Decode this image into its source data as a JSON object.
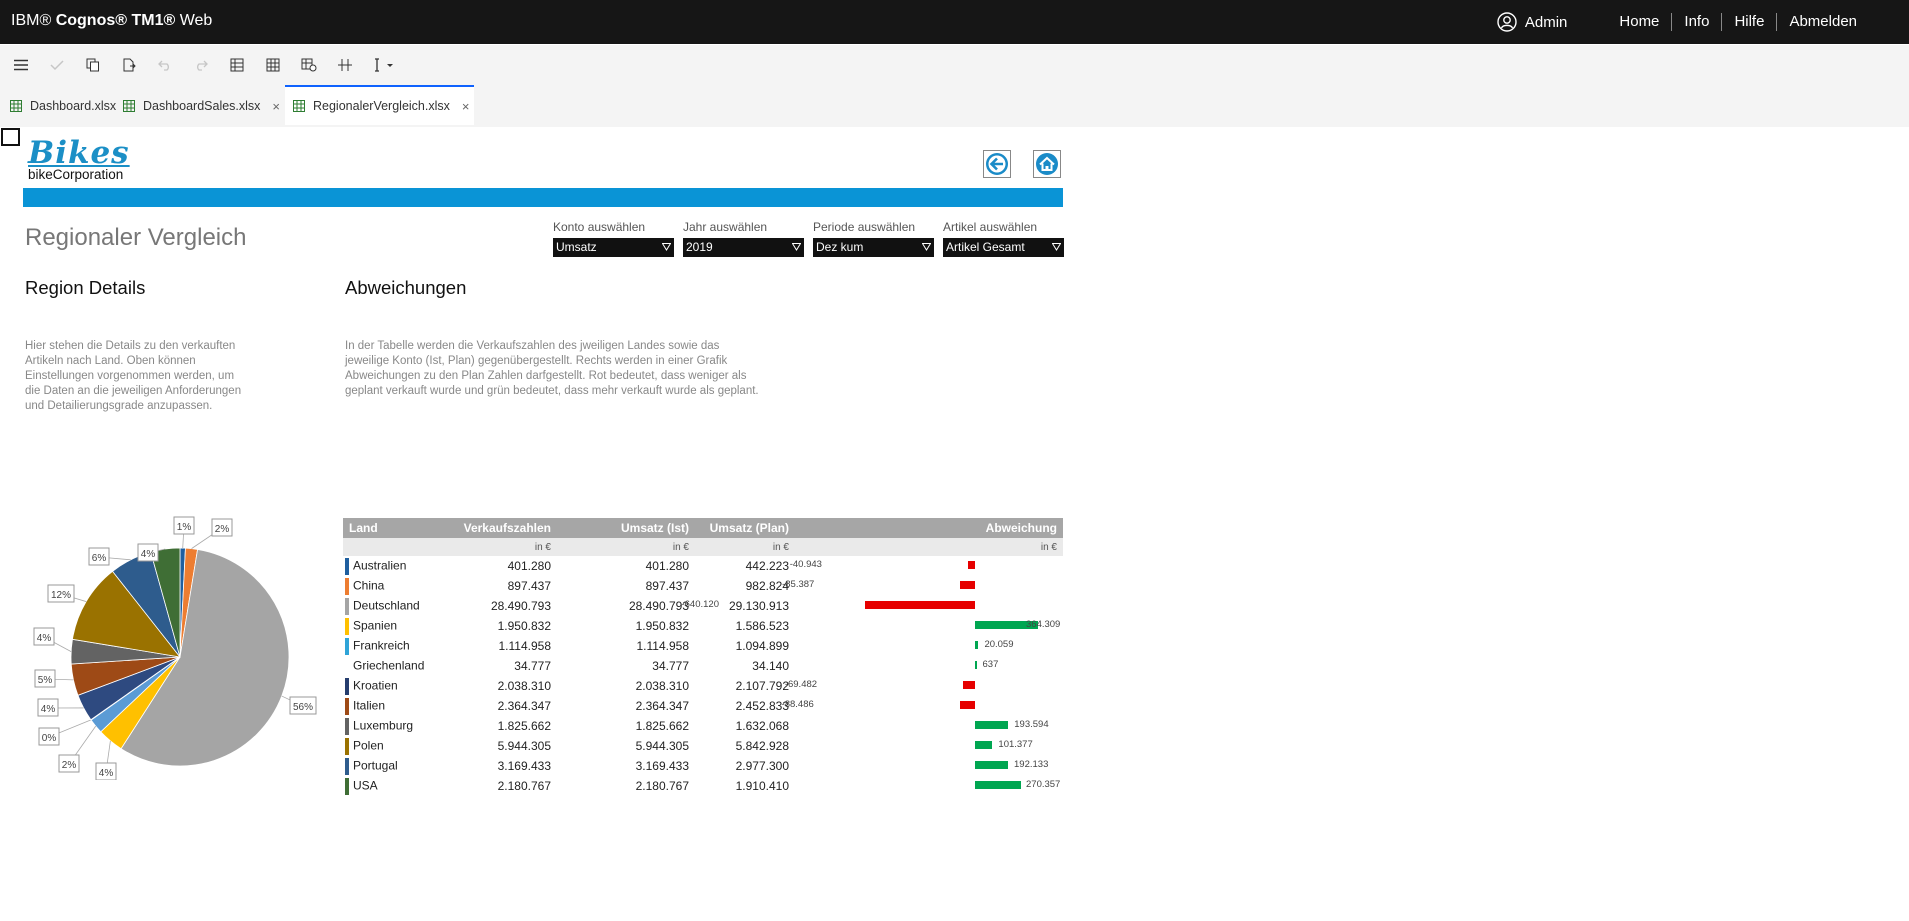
{
  "app": {
    "brand_prefix": "IBM® ",
    "brand_bold": "Cognos® TM1®",
    "brand_suffix": " Web",
    "user": "Admin",
    "nav": [
      "Home",
      "Info",
      "Hilfe",
      "Abmelden"
    ]
  },
  "toolbar": {
    "icons": [
      "menu-icon",
      "check-icon",
      "copy-icon",
      "paste-icon",
      "undo-icon",
      "redo-icon",
      "grid-icon",
      "grid-alt-icon",
      "grid-export-icon",
      "split-icon",
      "sandbox-icon"
    ]
  },
  "tabs": [
    {
      "label": "Dashboard.xlsx"
    },
    {
      "label": "DashboardSales.xlsx",
      "close": "×"
    },
    {
      "label": "RegionalerVergleich.xlsx",
      "close": "×"
    }
  ],
  "logo": {
    "bikes": "Bikes",
    "corp": "bikeCorporation"
  },
  "colors": {
    "accent": "#0a94d6",
    "negative": "#e60000",
    "positive": "#00a651"
  },
  "page": {
    "title": "Regionaler Vergleich"
  },
  "selectors": [
    {
      "label": "Konto auswählen",
      "value": "Umsatz"
    },
    {
      "label": "Jahr auswählen",
      "value": "2019"
    },
    {
      "label": "Periode auswählen",
      "value": "Dez kum"
    },
    {
      "label": "Artikel auswählen",
      "value": "Artikel Gesamt"
    }
  ],
  "region": {
    "heading": "Region Details",
    "text": [
      "Hier stehen die Details zu den verkauften",
      "Artikeln nach Land. Oben können",
      "Einstellungen vorgenommen werden, um",
      "die Daten an die jeweiligen Anforderungen",
      "und Detailierungsgrade anzupassen."
    ]
  },
  "abweichungen": {
    "heading": "Abweichungen",
    "text": [
      "In der Tabelle werden die Verkaufszahlen des jweiligen Landes sowie das",
      "jeweilige Konto (Ist, Plan) gegenübergestellt. Rechts werden in einer Grafik",
      "Abweichungen zu den Plan Zahlen darfgestellt. Rot bedeutet, dass weniger als",
      "geplant verkauft wurde und grün bedeutet, dass mehr verkauft wurde als geplant."
    ]
  },
  "table": {
    "headers": [
      "Land",
      "Verkaufszahlen",
      "Umsatz (Ist)",
      "Umsatz (Plan)",
      "Abweichung"
    ],
    "units": [
      "",
      "in €",
      "in €",
      "in €",
      "in €"
    ],
    "rows": [
      {
        "land": "Australien",
        "verkauf": "401.280",
        "ist": "401.280",
        "plan": "442.223",
        "abw": -40943,
        "abw_label": "-40.943",
        "color": "#1f5f9f"
      },
      {
        "land": "China",
        "verkauf": "897.437",
        "ist": "897.437",
        "plan": "982.824",
        "abw": -85387,
        "abw_label": "-85.387",
        "color": "#ed7d31"
      },
      {
        "land": "Deutschland",
        "verkauf": "28.490.793",
        "ist": "28.490.793",
        "plan": "29.130.913",
        "abw": -640120,
        "abw_label": "-640.120",
        "color": "#a5a5a5"
      },
      {
        "land": "Spanien",
        "verkauf": "1.950.832",
        "ist": "1.950.832",
        "plan": "1.586.523",
        "abw": 364309,
        "abw_label": "364.309",
        "color": "#ffc000"
      },
      {
        "land": "Frankreich",
        "verkauf": "1.114.958",
        "ist": "1.114.958",
        "plan": "1.094.899",
        "abw": 20059,
        "abw_label": "20.059",
        "color": "#2fa4d8"
      },
      {
        "land": "Griechenland",
        "verkauf": "34.777",
        "ist": "34.777",
        "plan": "34.140",
        "abw": 637,
        "abw_label": "637",
        "color": "#ffffff"
      },
      {
        "land": "Kroatien",
        "verkauf": "2.038.310",
        "ist": "2.038.310",
        "plan": "2.107.792",
        "abw": -69482,
        "abw_label": "-69.482",
        "color": "#253d6e"
      },
      {
        "land": "Italien",
        "verkauf": "2.364.347",
        "ist": "2.364.347",
        "plan": "2.452.833",
        "abw": -88486,
        "abw_label": "-88.486",
        "color": "#9e4a16"
      },
      {
        "land": "Luxemburg",
        "verkauf": "1.825.662",
        "ist": "1.825.662",
        "plan": "1.632.068",
        "abw": 193594,
        "abw_label": "193.594",
        "color": "#636363"
      },
      {
        "land": "Polen",
        "verkauf": "5.944.305",
        "ist": "5.944.305",
        "plan": "5.842.928",
        "abw": 101377,
        "abw_label": "101.377",
        "color": "#9a7200"
      },
      {
        "land": "Portugal",
        "verkauf": "3.169.433",
        "ist": "3.169.433",
        "plan": "2.977.300",
        "abw": 192133,
        "abw_label": "192.133",
        "color": "#2e5c8d"
      },
      {
        "land": "USA",
        "verkauf": "2.180.767",
        "ist": "2.180.767",
        "plan": "1.910.410",
        "abw": 270357,
        "abw_label": "270.357",
        "color": "#3f6e35"
      }
    ]
  },
  "chart_data": {
    "type": "pie",
    "categories": [
      "Australien",
      "China",
      "Deutschland",
      "Spanien",
      "Frankreich",
      "Griechenland",
      "Kroatien",
      "Italien",
      "Luxemburg",
      "Polen",
      "Portugal",
      "USA"
    ],
    "values": [
      401280,
      897437,
      28490793,
      1950832,
      1114958,
      34777,
      2038310,
      2364347,
      1825662,
      5944305,
      3169433,
      2180767
    ],
    "labels": [
      "1%",
      "2%",
      "56%",
      "4%",
      "2%",
      "0%",
      "4%",
      "5%",
      "4%",
      "12%",
      "6%",
      "4%"
    ],
    "colors": [
      "#1f5f9f",
      "#ed7d31",
      "#a5a5a5",
      "#ffc000",
      "#5b9bd5",
      "#1f3864",
      "#2e4a80",
      "#9e4a16",
      "#636363",
      "#9a7200",
      "#2e5c8d",
      "#3f6e35"
    ]
  }
}
